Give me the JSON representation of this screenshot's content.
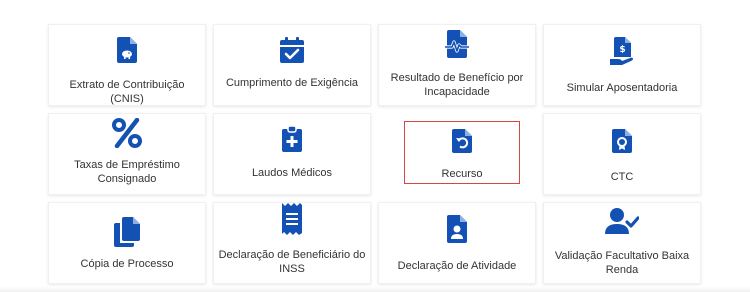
{
  "colors": {
    "icon_blue": "#1351b4",
    "text": "#333333",
    "selected_border": "#d9453f"
  },
  "cards": [
    {
      "label": "Extrato de Contribuição (CNIS)",
      "icon": "document-piggybank-icon"
    },
    {
      "label": "Cumprimento de Exigência",
      "icon": "calendar-check-icon"
    },
    {
      "label": "Resultado de Benefício por Incapacidade",
      "icon": "document-heartbeat-icon"
    },
    {
      "label": "Simular Aposentadoria",
      "icon": "document-dollar-hand-icon"
    },
    {
      "label": "Taxas de Empréstimo Consignado",
      "icon": "percent-icon"
    },
    {
      "label": "Laudos Médicos",
      "icon": "clipboard-medical-icon"
    },
    {
      "label": "Recurso",
      "icon": "document-undo-icon"
    },
    {
      "label": "CTC",
      "icon": "document-award-icon"
    },
    {
      "label": "Cópia de Processo",
      "icon": "copy-documents-icon"
    },
    {
      "label": "Declaração de Beneficiário do INSS",
      "icon": "receipt-icon"
    },
    {
      "label": "Declaração de Atividade",
      "icon": "document-user-icon"
    },
    {
      "label": "Validação Facultativo Baixa Renda",
      "icon": "user-check-icon"
    }
  ]
}
